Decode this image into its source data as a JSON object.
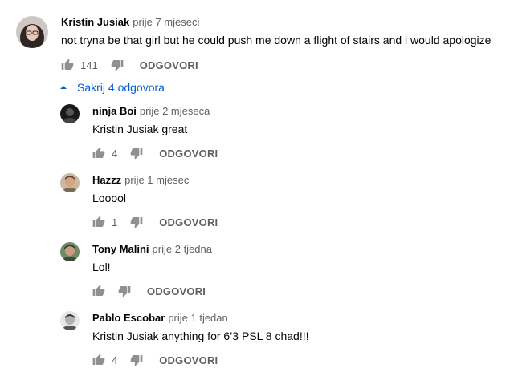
{
  "top_comment": {
    "author": "Kristin Jusiak",
    "time": "prije 7 mjeseci",
    "text": "not tryna be that girl but he could push me down a flight of stairs and i would apologize",
    "likes": "141",
    "reply_label": "ODGOVORI"
  },
  "replies_toggle": {
    "label": "Sakrij 4 odgovora"
  },
  "replies": [
    {
      "author": "ninja Boi",
      "time": "prije 2 mjeseca",
      "text": "Kristin Jusiak great",
      "likes": "4",
      "reply_label": "ODGOVORI"
    },
    {
      "author": "Hazzz",
      "time": "prije 1 mjesec",
      "text": "Looool",
      "likes": "1",
      "reply_label": "ODGOVORI"
    },
    {
      "author": "Tony Malini",
      "time": "prije 2 tjedna",
      "text": "Lol!",
      "likes": "",
      "reply_label": "ODGOVORI"
    },
    {
      "author": "Pablo Escobar",
      "time": "prije 1 tjedan",
      "text": "Kristin Jusiak anything for 6’3 PSL 8 chad!!!",
      "likes": "4",
      "reply_label": "ODGOVORI"
    }
  ],
  "icons": {
    "like": "thumb-up-icon",
    "dislike": "thumb-down-icon",
    "toggle": "arrow-up-icon"
  },
  "colors": {
    "link": "#065fd4",
    "secondary_text": "#606060",
    "icon": "#909090"
  }
}
